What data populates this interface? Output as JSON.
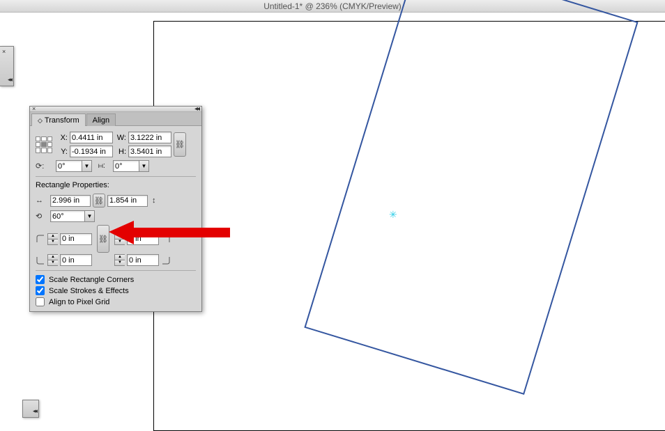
{
  "titlebar": "Untitled-1* @ 236% (CMYK/Preview)",
  "panel": {
    "tabs": [
      "Transform",
      "Align"
    ],
    "active_tab": 0,
    "x_label": "X:",
    "y_label": "Y:",
    "w_label": "W:",
    "h_label": "H:",
    "x": "0.4411 in",
    "y": "-0.1934 in",
    "w": "3.1222 in",
    "h": "3.5401 in",
    "rotate_label": "0°",
    "shear_label": "0°"
  },
  "rect_props": {
    "title": "Rectangle Properties:",
    "width": "2.996 in",
    "height": "1.854 in",
    "angle": "60°",
    "corner_tl": "0 in",
    "corner_tr": "0 in",
    "corner_bl": "0 in",
    "corner_br": "0 in"
  },
  "options": {
    "scale_corners": {
      "label": "Scale Rectangle Corners",
      "checked": true
    },
    "scale_strokes": {
      "label": "Scale Strokes & Effects",
      "checked": true
    },
    "pixel_grid": {
      "label": "Align to Pixel Grid",
      "checked": false
    }
  },
  "colors": {
    "stroke": "#3456a0",
    "arrow": "#e30000"
  }
}
